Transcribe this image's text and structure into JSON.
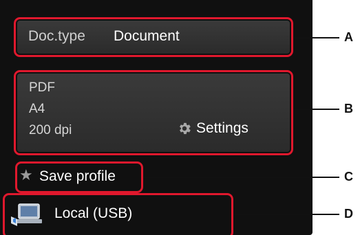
{
  "doc_type": {
    "label": "Doc.type",
    "value": "Document"
  },
  "scan_settings": {
    "format": "PDF",
    "paper_size": "A4",
    "resolution": "200 dpi",
    "settings_label": "Settings",
    "settings_icon": "gear-icon"
  },
  "save_profile": {
    "label": "Save profile",
    "icon": "star-icon"
  },
  "destination": {
    "label": "Local (USB)",
    "icon": "computer-device-icon"
  },
  "callouts": [
    "A",
    "B",
    "C",
    "D"
  ],
  "colors": {
    "callout_border": "#e0182d",
    "screen_bg": "#101010",
    "button_bg": "#333333"
  }
}
